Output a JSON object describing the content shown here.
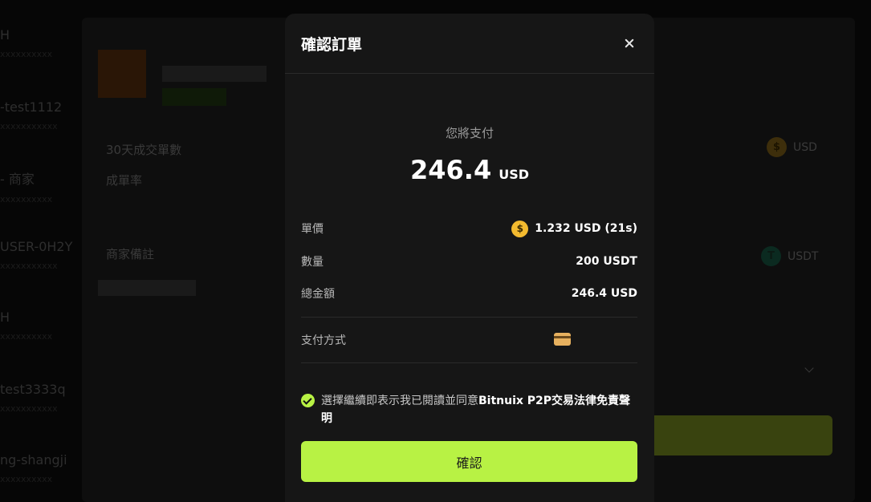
{
  "background": {
    "sidebar_items": [
      {
        "name": "H",
        "sub": "xxxxxxxxxx"
      },
      {
        "name": "-test1112",
        "sub": "xxxxxxxxxxx"
      },
      {
        "name": "- 商家",
        "sub": "xxxxxxxxxx"
      },
      {
        "name": "USER-0H2Y",
        "sub": "xxxxxxxxxxx"
      },
      {
        "name": "H",
        "sub": "xxxxxxxxxx"
      },
      {
        "name": "test3333q",
        "sub": "xxxxxxxxxxx"
      },
      {
        "name": "ng-shangji",
        "sub": "xxxxxxxxxx"
      }
    ],
    "stats": {
      "orders_30d_label": "30天成交單數",
      "completion_rate_label": "成單率"
    },
    "merchant_note_label": "商家備註",
    "fiat_currency": "USD",
    "crypto_currency": "USDT"
  },
  "modal": {
    "title": "確認訂單",
    "pay_caption": "您將支付",
    "pay_amount": "246.4",
    "pay_currency": "USD",
    "rows": {
      "unit_price_label": "單價",
      "unit_price_value": "1.232 USD (21s)",
      "quantity_label": "數量",
      "quantity_value": "200 USDT",
      "total_label": "總金額",
      "total_value": "246.4 USD",
      "payment_method_label": "支付方式"
    },
    "agreement_text": "選擇繼續即表示我已閱讀並同意",
    "agreement_link": "Bitnuix P2P交易法律免責聲明",
    "confirm_label": "確認"
  },
  "colors": {
    "accent": "#b8f244",
    "usd_coin": "#f3ba2f",
    "usdt_coin": "#26a17b",
    "card": "#e7b15f"
  },
  "icons": {
    "close": "close-icon",
    "usd_coin": "dollar-coin-icon",
    "card": "credit-card-icon",
    "check": "check-circle-icon"
  }
}
